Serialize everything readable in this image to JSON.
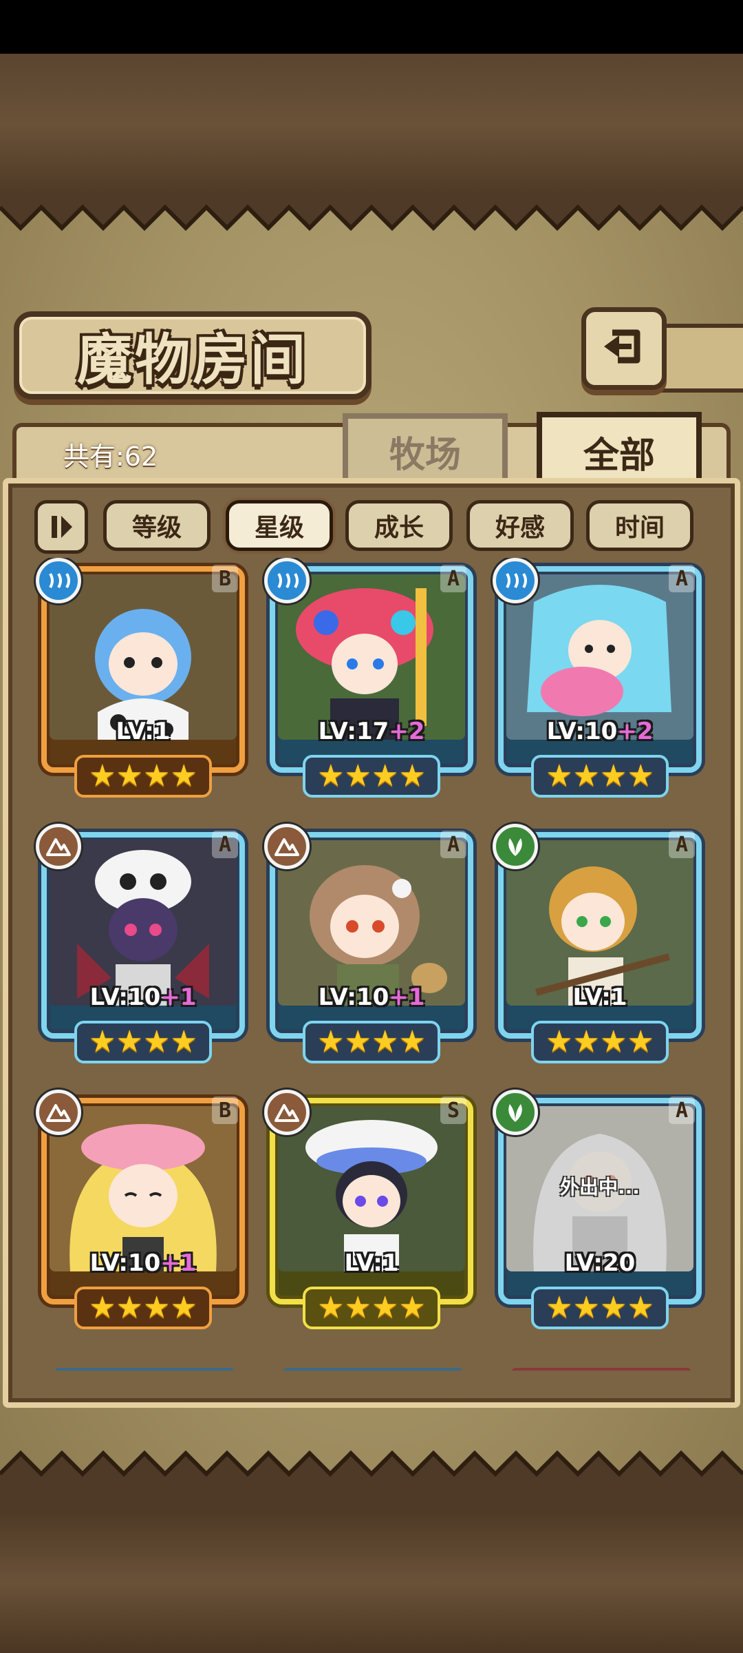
{
  "screen": {
    "title": "魔物房间",
    "back_button_icon": "return-arrow-icon"
  },
  "header": {
    "total_count": "共有:62",
    "tabs": [
      {
        "label": "牧场",
        "active": false
      },
      {
        "label": "全部",
        "active": true
      }
    ]
  },
  "filters": {
    "sort_toggle_icon": "pause-sort-icon",
    "buttons": [
      {
        "label": "等级",
        "active": false
      },
      {
        "label": "星级",
        "active": true
      },
      {
        "label": "成长",
        "active": false
      },
      {
        "label": "好感",
        "active": false
      },
      {
        "label": "时间",
        "active": false
      }
    ]
  },
  "monsters": [
    {
      "element": "water",
      "rarity": "B",
      "level": "LV:1",
      "bonus": "",
      "stars": 4,
      "hair": "#6ab0ee",
      "outfit": "#f4f4f4",
      "status": ""
    },
    {
      "element": "water",
      "rarity": "A",
      "level": "LV:17",
      "bonus": "+2",
      "stars": 4,
      "hair": "#2a2a3a",
      "outfit": "#e84a6a",
      "status": ""
    },
    {
      "element": "water",
      "rarity": "A",
      "level": "LV:10",
      "bonus": "+2",
      "stars": 4,
      "hair": "#7ad8f0",
      "outfit": "#f07ab0",
      "status": ""
    },
    {
      "element": "earth",
      "rarity": "A",
      "level": "LV:10",
      "bonus": "+1",
      "stars": 4,
      "hair": "#4a3a6a",
      "outfit": "#f4f4f4",
      "status": ""
    },
    {
      "element": "earth",
      "rarity": "A",
      "level": "LV:10",
      "bonus": "+1",
      "stars": 4,
      "hair": "#b08a6a",
      "outfit": "#6a7a4a",
      "status": ""
    },
    {
      "element": "wood",
      "rarity": "A",
      "level": "LV:1",
      "bonus": "",
      "stars": 4,
      "hair": "#d8a040",
      "outfit": "#f0e8d8",
      "status": ""
    },
    {
      "element": "earth",
      "rarity": "B",
      "level": "LV:10",
      "bonus": "+1",
      "stars": 4,
      "hair": "#f4d860",
      "outfit": "#f4a0b8",
      "status": ""
    },
    {
      "element": "earth",
      "rarity": "S",
      "level": "LV:1",
      "bonus": "",
      "stars": 4,
      "hair": "#2a2a3a",
      "outfit": "#f4f4f4",
      "status": ""
    },
    {
      "element": "wood",
      "rarity": "A",
      "level": "LV:20",
      "bonus": "",
      "stars": 4,
      "hair": "#d8d8d8",
      "outfit": "#9a9a9a",
      "status": "外出中..."
    }
  ],
  "colors": {
    "rarity_A_frame": "#7fd4ee",
    "rarity_B_frame": "#f0a040",
    "rarity_S_frame": "#f2e048",
    "level_bonus": "#e66ad8",
    "star": "#ffcc22",
    "element_water": "#2a8ad4",
    "element_earth": "#8a5a3a",
    "element_wood": "#3a8a3a"
  }
}
